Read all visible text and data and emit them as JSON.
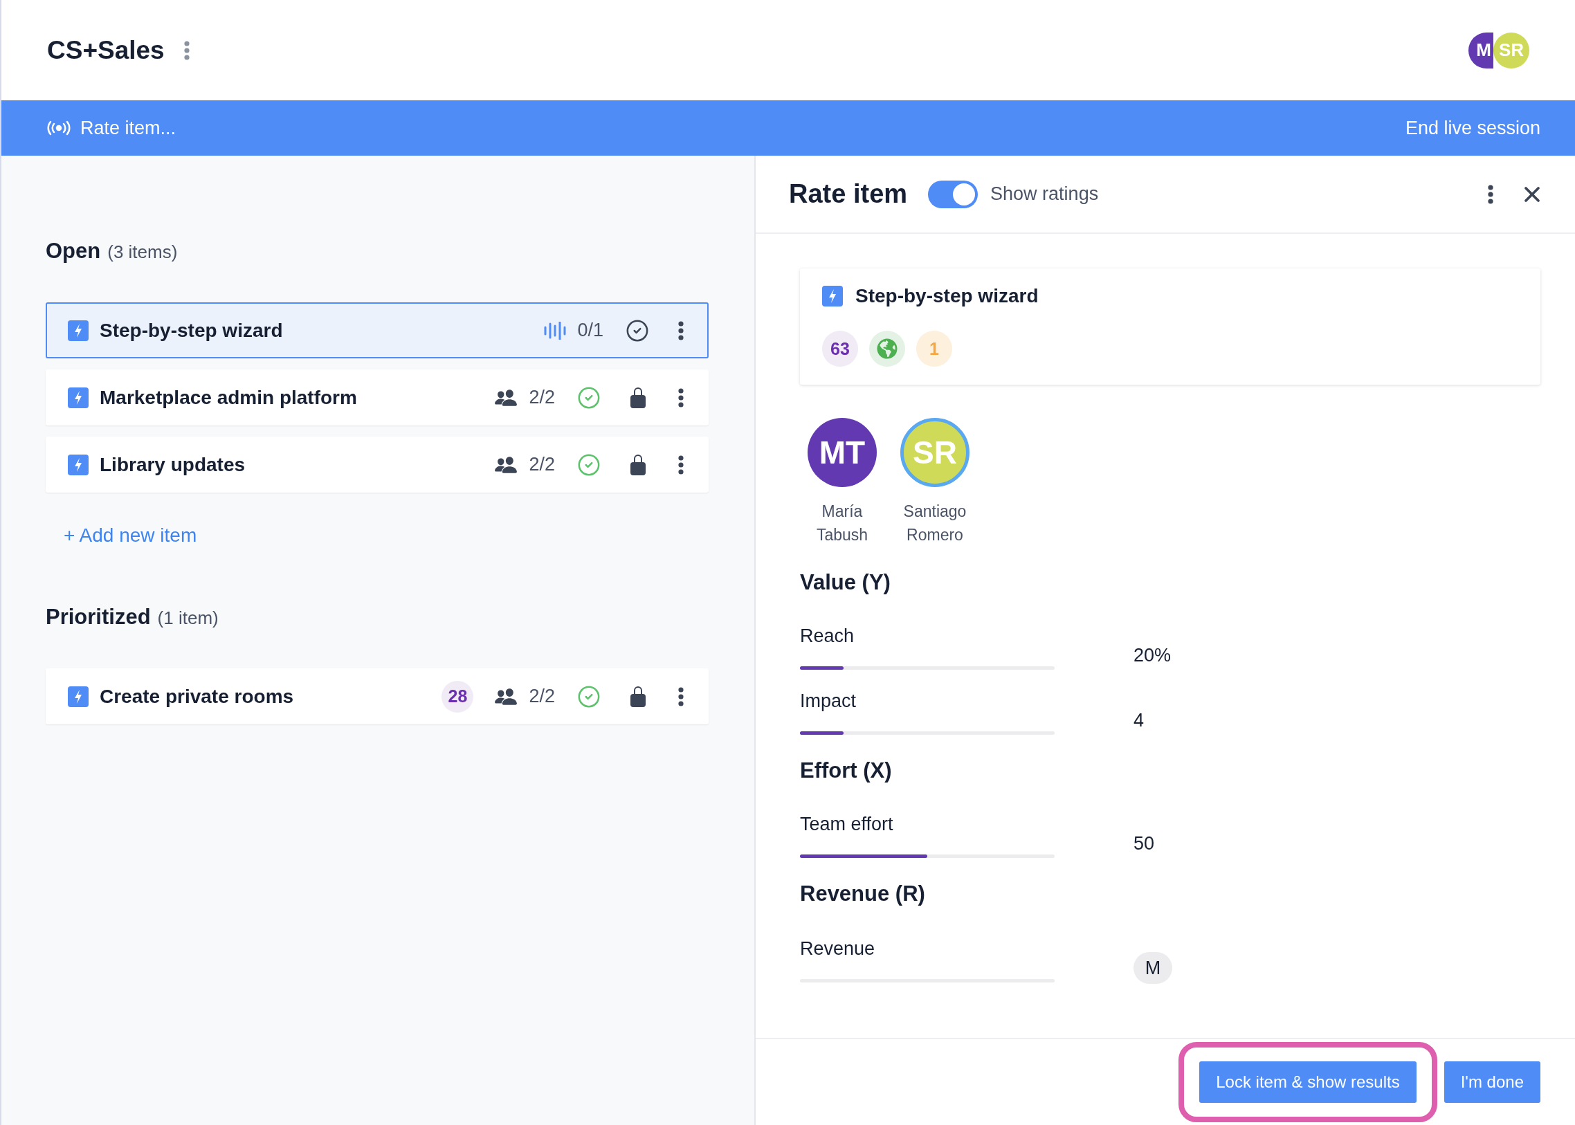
{
  "header": {
    "title": "CS+Sales",
    "avatars": [
      {
        "initials": "M",
        "color": "#6239b0"
      },
      {
        "initials": "SR",
        "color": "#cfdb58"
      }
    ]
  },
  "live_bar": {
    "label": "Rate item...",
    "action": "End live session"
  },
  "sections": [
    {
      "title": "Open",
      "count": "(3 items)",
      "items": [
        {
          "title": "Step-by-step wizard",
          "selected": true,
          "kind": "live",
          "votes": "0/1",
          "rated": false,
          "locked": false
        },
        {
          "title": "Marketplace admin platform",
          "selected": false,
          "kind": "team",
          "votes": "2/2",
          "rated": true,
          "locked": true
        },
        {
          "title": "Library updates",
          "selected": false,
          "kind": "team",
          "votes": "2/2",
          "rated": true,
          "locked": true
        }
      ],
      "add_label": "+ Add new item"
    },
    {
      "title": "Prioritized",
      "count": "(1 item)",
      "items": [
        {
          "title": "Create private rooms",
          "selected": false,
          "score": "28",
          "kind": "team",
          "votes": "2/2",
          "rated": true,
          "locked": true
        }
      ]
    }
  ],
  "panel": {
    "title": "Rate item",
    "toggle": {
      "label": "Show ratings",
      "on": true
    },
    "card": {
      "title": "Step-by-step wizard",
      "badges": [
        {
          "kind": "score",
          "text": "63"
        },
        {
          "kind": "globe"
        },
        {
          "kind": "priority",
          "text": "1"
        }
      ]
    },
    "raters": [
      {
        "initials": "MT",
        "name": "María Tabush",
        "color": "#6239b0",
        "selected": false
      },
      {
        "initials": "SR",
        "name": "Santiago Romero",
        "color": "#cfdb58",
        "selected": true
      }
    ],
    "criteria": [
      {
        "title": "Value (Y)",
        "fields": [
          {
            "kind": "slider",
            "label": "Reach",
            "value": "20%",
            "level": 0.17
          },
          {
            "kind": "slider",
            "label": "Impact",
            "value": "4",
            "level": 0.17
          }
        ]
      },
      {
        "title": "Effort (X)",
        "fields": [
          {
            "kind": "slider",
            "label": "Team effort",
            "value": "50",
            "level": 0.5
          }
        ]
      },
      {
        "title": "Revenue (R)",
        "fields": [
          {
            "kind": "choice",
            "label": "Revenue",
            "value": "M"
          }
        ]
      }
    ],
    "buttons": [
      {
        "label": "Lock item & show results",
        "highlighted": true
      },
      {
        "label": "I'm done",
        "highlighted": false
      }
    ]
  }
}
